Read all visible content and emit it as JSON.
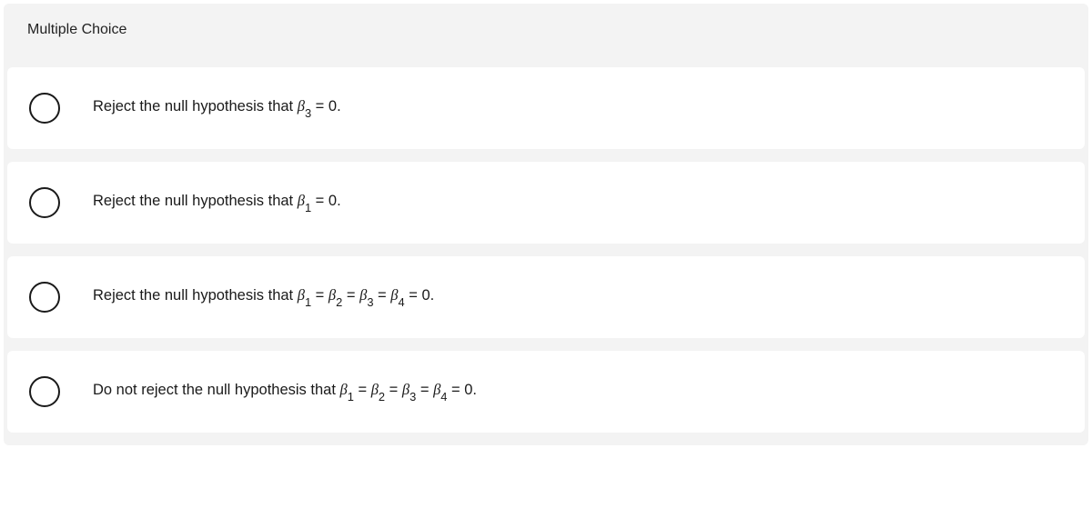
{
  "header": "Multiple Choice",
  "options": [
    {
      "prefix": "Reject the null hypothesis that ",
      "terms": [
        {
          "sym": "β",
          "sub": "3"
        }
      ],
      "suffix": " = 0."
    },
    {
      "prefix": "Reject the null hypothesis that ",
      "terms": [
        {
          "sym": "β",
          "sub": "1"
        }
      ],
      "suffix": " = 0."
    },
    {
      "prefix": "Reject the null hypothesis that ",
      "terms": [
        {
          "sym": "β",
          "sub": "1"
        },
        {
          "sym": "β",
          "sub": "2"
        },
        {
          "sym": "β",
          "sub": "3"
        },
        {
          "sym": "β",
          "sub": "4"
        }
      ],
      "suffix": " = 0."
    },
    {
      "prefix": "Do not reject the null hypothesis that ",
      "terms": [
        {
          "sym": "β",
          "sub": "1"
        },
        {
          "sym": "β",
          "sub": "2"
        },
        {
          "sym": "β",
          "sub": "3"
        },
        {
          "sym": "β",
          "sub": "4"
        }
      ],
      "suffix": " = 0."
    }
  ]
}
